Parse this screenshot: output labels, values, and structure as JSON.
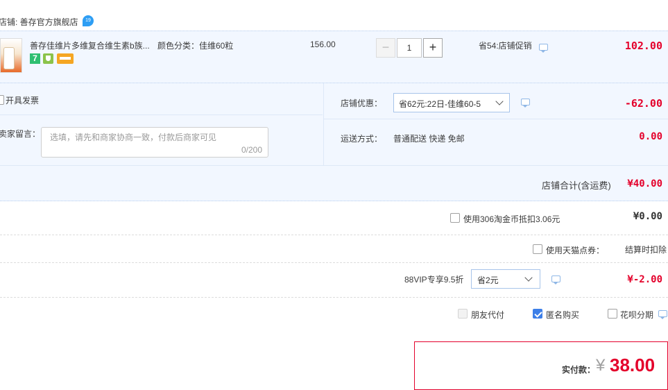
{
  "store": {
    "label": "店铺: 善存官方旗舰店",
    "badge": "19"
  },
  "item": {
    "title": "善存佳维片多维复合维生素b族...",
    "spec": "颜色分类：佳维60粒",
    "price": "156.00",
    "quantity": "1",
    "minus": "−",
    "plus": "+",
    "promo": "省54:店铺促销",
    "subtotal": "102.00",
    "tag1": "7"
  },
  "invoice": {
    "label": "开具发票"
  },
  "message": {
    "label": "卖家留言：",
    "placeholder": "选填，请先和商家协商一致，付款后商家可见",
    "counter": "0/200"
  },
  "store_discount": {
    "label": "店铺优惠：",
    "selected": "省62元:22日-佳维60-5",
    "amount": "-62.00"
  },
  "shipping": {
    "label": "运送方式：",
    "value": "普通配送 快递 免邮",
    "amount": "0.00"
  },
  "store_total": {
    "label": "店铺合计(含运费)",
    "amount": "¥40.00"
  },
  "coins": {
    "label": "使用306淘金币抵扣3.06元",
    "amount": "¥0.00"
  },
  "tmall_points": {
    "label": "使用天猫点券：",
    "value": "结算时扣除"
  },
  "vip": {
    "label": "88VIP专享9.5折",
    "selected": "省2元",
    "amount": "¥-2.00"
  },
  "options": {
    "friend_pay": "朋友代付",
    "anonymous": "匿名购买",
    "huabei": "花呗分期"
  },
  "payment": {
    "label": "实付款：",
    "currency": "¥",
    "amount": "38.00"
  },
  "colors": {
    "accent_red": "#e4002b",
    "row_bg": "#f2f7ff",
    "border_blue": "#b6cdee",
    "checkbox_blue": "#3d7fe8"
  }
}
